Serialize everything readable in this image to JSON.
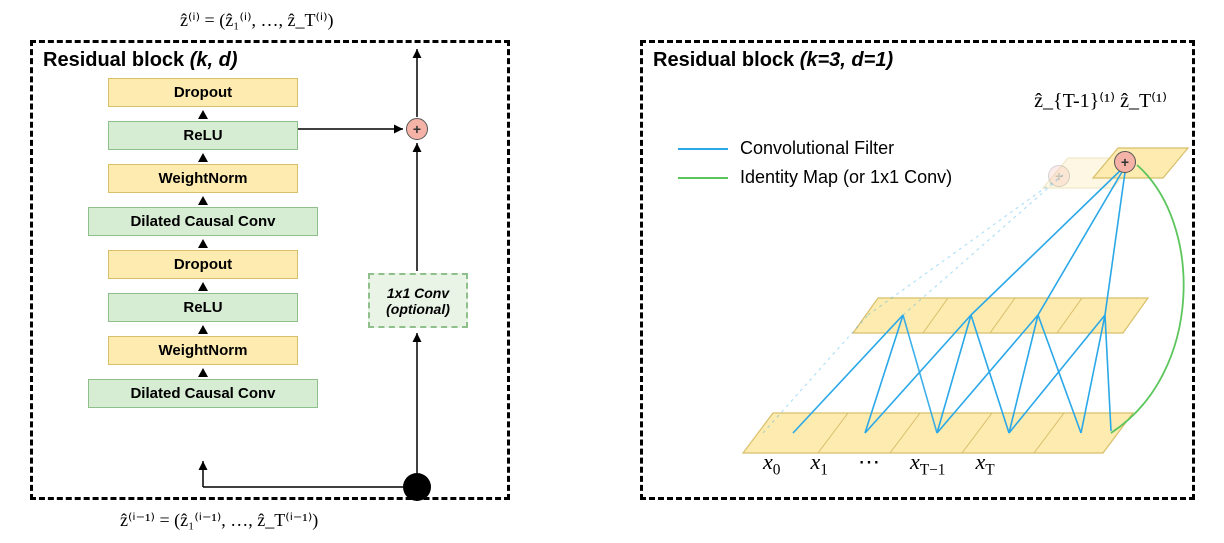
{
  "left": {
    "title_prefix": "Residual block ",
    "title_params": "(k, d)",
    "eq_top": "ẑ⁽ⁱ⁾ = (ẑ₁⁽ⁱ⁾, …, ẑ_T⁽ⁱ⁾)",
    "eq_bottom": "ẑ⁽ⁱ⁻¹⁾ = (ẑ₁⁽ⁱ⁻¹⁾, …, ẑ_T⁽ⁱ⁻¹⁾)",
    "layers": [
      {
        "label": "Dropout",
        "class": "yellow",
        "wide": false
      },
      {
        "label": "ReLU",
        "class": "green",
        "wide": false
      },
      {
        "label": "WeightNorm",
        "class": "yellow",
        "wide": false
      },
      {
        "label": "Dilated Causal Conv",
        "class": "green",
        "wide": true
      },
      {
        "label": "Dropout",
        "class": "yellow",
        "wide": false
      },
      {
        "label": "ReLU",
        "class": "green",
        "wide": false
      },
      {
        "label": "WeightNorm",
        "class": "yellow",
        "wide": false
      },
      {
        "label": "Dilated Causal Conv",
        "class": "green",
        "wide": true
      }
    ],
    "optional_line1": "1x1 Conv",
    "optional_line2": "(optional)",
    "plus_symbol": "+"
  },
  "right": {
    "title_prefix": "Residual block ",
    "title_params": "(k=3, d=1)",
    "labels_top": "ẑ_{T-1}⁽¹⁾  ẑ_T⁽¹⁾",
    "legend_conv": "Convolutional Filter",
    "legend_identity": "Identity Map (or 1x1 Conv)",
    "xlabels": [
      "x₀",
      "x₁",
      "⋯",
      "x_{T-1}",
      "x_T"
    ],
    "plus_symbol": "+"
  },
  "diagram": {
    "description": "Two side-by-side illustrations of a TCN residual block. Left: stacked layer list with skip/residual 1x1 conv path joining at an addition node. Right: dilated causal convolution connectivity for k=3, d=1 over a 1D sequence with an identity/1x1-conv skip from input to output.",
    "left_block": {
      "input": "ẑ⁽ⁱ⁻¹⁾",
      "output": "ẑ⁽ⁱ⁾",
      "main_branch_layers": [
        "Dilated Causal Conv",
        "WeightNorm",
        "ReLU",
        "Dropout",
        "Dilated Causal Conv",
        "WeightNorm",
        "ReLU",
        "Dropout"
      ],
      "skip_branch": "1x1 Conv (optional)",
      "merge": "add"
    },
    "right_block": {
      "kernel_size": 3,
      "dilation": 1,
      "num_layers_shown": 3,
      "input_nodes": [
        "x0",
        "x1",
        "...",
        "x_{T-1}",
        "x_T"
      ],
      "output_nodes": [
        "ẑ_{T-1}^(1)",
        "ẑ_T^(1)"
      ],
      "edge_colors": {
        "conv": "#2aa8e8",
        "identity": "#5cc65c"
      }
    }
  }
}
